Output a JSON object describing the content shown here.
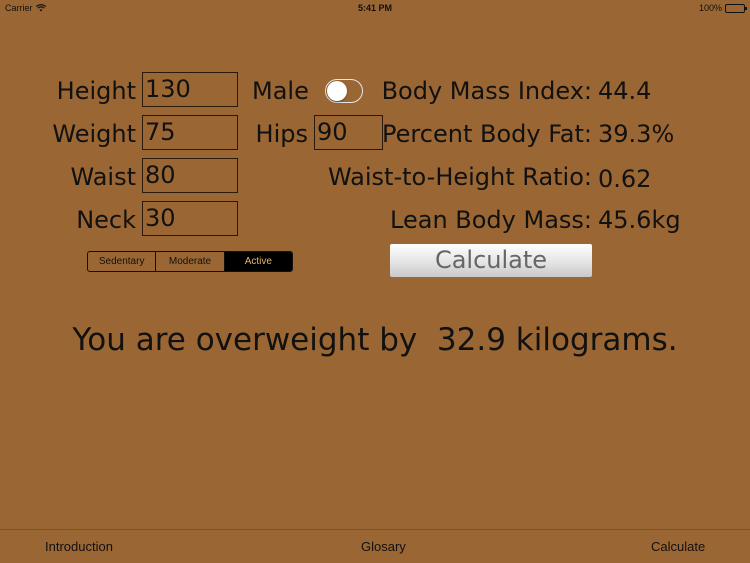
{
  "status": {
    "carrier": "Carrier",
    "time": "5:41 PM",
    "battery": "100%"
  },
  "form": {
    "height_label": "Height",
    "height_value": "130",
    "weight_label": "Weight",
    "weight_value": "75",
    "waist_label": "Waist",
    "waist_value": "80",
    "neck_label": "Neck",
    "neck_value": "30",
    "gender_label": "Male",
    "gender_toggle_on": false,
    "hips_label": "Hips",
    "hips_value": "90"
  },
  "results": {
    "bmi_label": "Body Mass Index:",
    "bmi_value": "44.4",
    "bodyfat_label": "Percent Body Fat:",
    "bodyfat_value": "39.3%",
    "whr_label": "Waist-to-Height Ratio:",
    "whr_value": "0.62",
    "lbm_label": "Lean Body Mass:",
    "lbm_value": "45.6kg"
  },
  "activity": {
    "options": [
      "Sedentary",
      "Moderate",
      "Active"
    ],
    "selected": "Active"
  },
  "calculate_button": "Calculate",
  "message": "You are overweight by  32.9 kilograms.",
  "tabs": [
    "Introduction",
    "Glosary",
    "Calculate"
  ],
  "colors": {
    "background": "#9a6633",
    "segment_active_text": "#e8b46a"
  }
}
